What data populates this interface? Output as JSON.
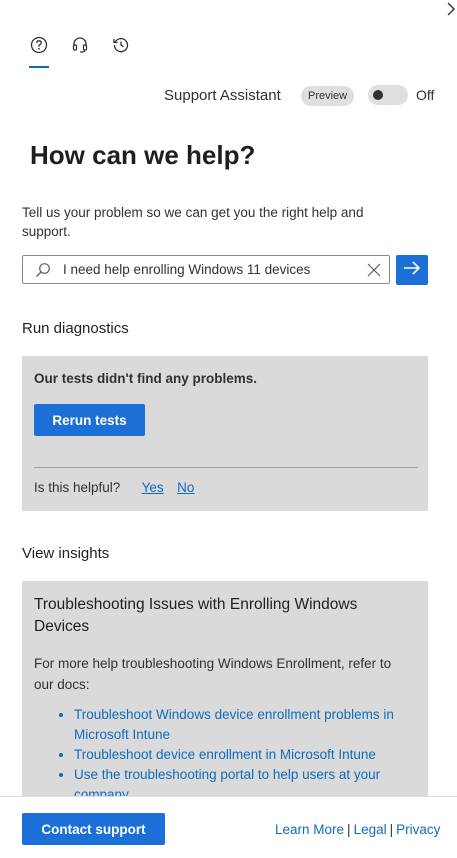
{
  "tabs": [
    {
      "icon": "help-circle-icon",
      "label": ""
    },
    {
      "icon": "headset-icon",
      "label": ""
    },
    {
      "icon": "history-icon",
      "label": ""
    }
  ],
  "assistant": {
    "label": "Support Assistant",
    "badge": "Preview",
    "toggle_state": "Off"
  },
  "heading": "How can we help?",
  "intro": "Tell us your problem so we can get you the right help and support.",
  "search": {
    "value": "I need help enrolling Windows 11 devices",
    "placeholder": ""
  },
  "diagnostics": {
    "title": "Run diagnostics",
    "result": "Our tests didn't find any problems.",
    "rerun_label": "Rerun tests",
    "helpful_question": "Is this helpful?",
    "yes_label": "Yes",
    "no_label": "No"
  },
  "insights": {
    "title": "View insights",
    "card_title": "Troubleshooting Issues with Enrolling Windows Devices",
    "card_text": "For more help troubleshooting Windows Enrollment, refer to our docs:",
    "links": [
      "Troubleshoot Windows device enrollment problems in Microsoft Intune",
      "Troubleshoot device enrollment in Microsoft Intune",
      "Use the troubleshooting portal to help users at your company"
    ]
  },
  "footer": {
    "contact_label": "Contact support",
    "learn_more": "Learn More",
    "legal": "Legal",
    "privacy": "Privacy",
    "separator": "|"
  },
  "colors": {
    "accent": "#1b6fd6",
    "link": "#0f6cbd",
    "panel_bg": "#dadada"
  }
}
